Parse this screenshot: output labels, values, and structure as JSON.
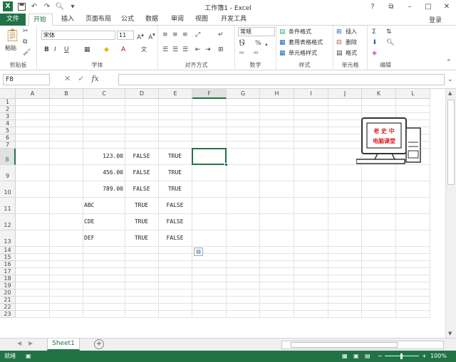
{
  "titlebar": {
    "title": "工作簿1 - Excel",
    "min": "–",
    "max": "□",
    "close": "✕",
    "help": "?",
    "restore": "⧉"
  },
  "tabs": [
    {
      "label": "文件"
    },
    {
      "label": "开始"
    },
    {
      "label": "插入"
    },
    {
      "label": "页面布局"
    },
    {
      "label": "公式"
    },
    {
      "label": "数据"
    },
    {
      "label": "审阅"
    },
    {
      "label": "视图"
    },
    {
      "label": "开发工具"
    }
  ],
  "login": "登录",
  "ribbon": {
    "clipboard": {
      "label": "剪贴板",
      "paste": "粘贴"
    },
    "font": {
      "label": "字体",
      "name": "宋体",
      "size": "11",
      "bold": "B",
      "italic": "I",
      "underline": "U"
    },
    "alignment": {
      "label": "对齐方式"
    },
    "number": {
      "label": "数字",
      "format": "常规",
      "percent": "%",
      "comma": "❟"
    },
    "styles": {
      "label": "样式",
      "conditional": "条件格式",
      "table": "套用表格格式",
      "cell": "单元格样式"
    },
    "cells": {
      "label": "单元格",
      "insert": "插入",
      "delete": "删除",
      "format": "格式"
    },
    "editing": {
      "label": "编辑"
    }
  },
  "formula": {
    "namebox": "F8",
    "fx": "fx",
    "cancel": "✕",
    "enter": "✓",
    "value": ""
  },
  "columns": [
    "A",
    "B",
    "C",
    "D",
    "E",
    "F",
    "G",
    "H",
    "I",
    "J",
    "K",
    "L"
  ],
  "selected_column": "F",
  "rows": [
    "1",
    "2",
    "3",
    "4",
    "5",
    "6",
    "7",
    "8",
    "9",
    "10",
    "11",
    "12",
    "13",
    "14",
    "15",
    "16",
    "17",
    "18",
    "19",
    "20",
    "21",
    "22",
    "23"
  ],
  "selected_row": "8",
  "cells": {
    "C8": "123.00",
    "D8": "FALSE",
    "E8": "TRUE",
    "C9": "456.00",
    "D9": "FALSE",
    "E9": "TRUE",
    "C10": "789.00",
    "D10": "FALSE",
    "E10": "TRUE",
    "C11": "ABC",
    "D11": "TRUE",
    "E11": "FALSE",
    "C12": "CDE",
    "D12": "TRUE",
    "E12": "FALSE",
    "C13": "DEF",
    "D13": "TRUE",
    "E13": "FALSE"
  },
  "logo": {
    "line1": "老 史 中",
    "line2": "电脑课堂"
  },
  "sheet": {
    "name": "Sheet1",
    "add": "+"
  },
  "status": {
    "ready": "就绪",
    "zoom": "100%",
    "zoom_minus": "−",
    "zoom_plus": "+"
  }
}
